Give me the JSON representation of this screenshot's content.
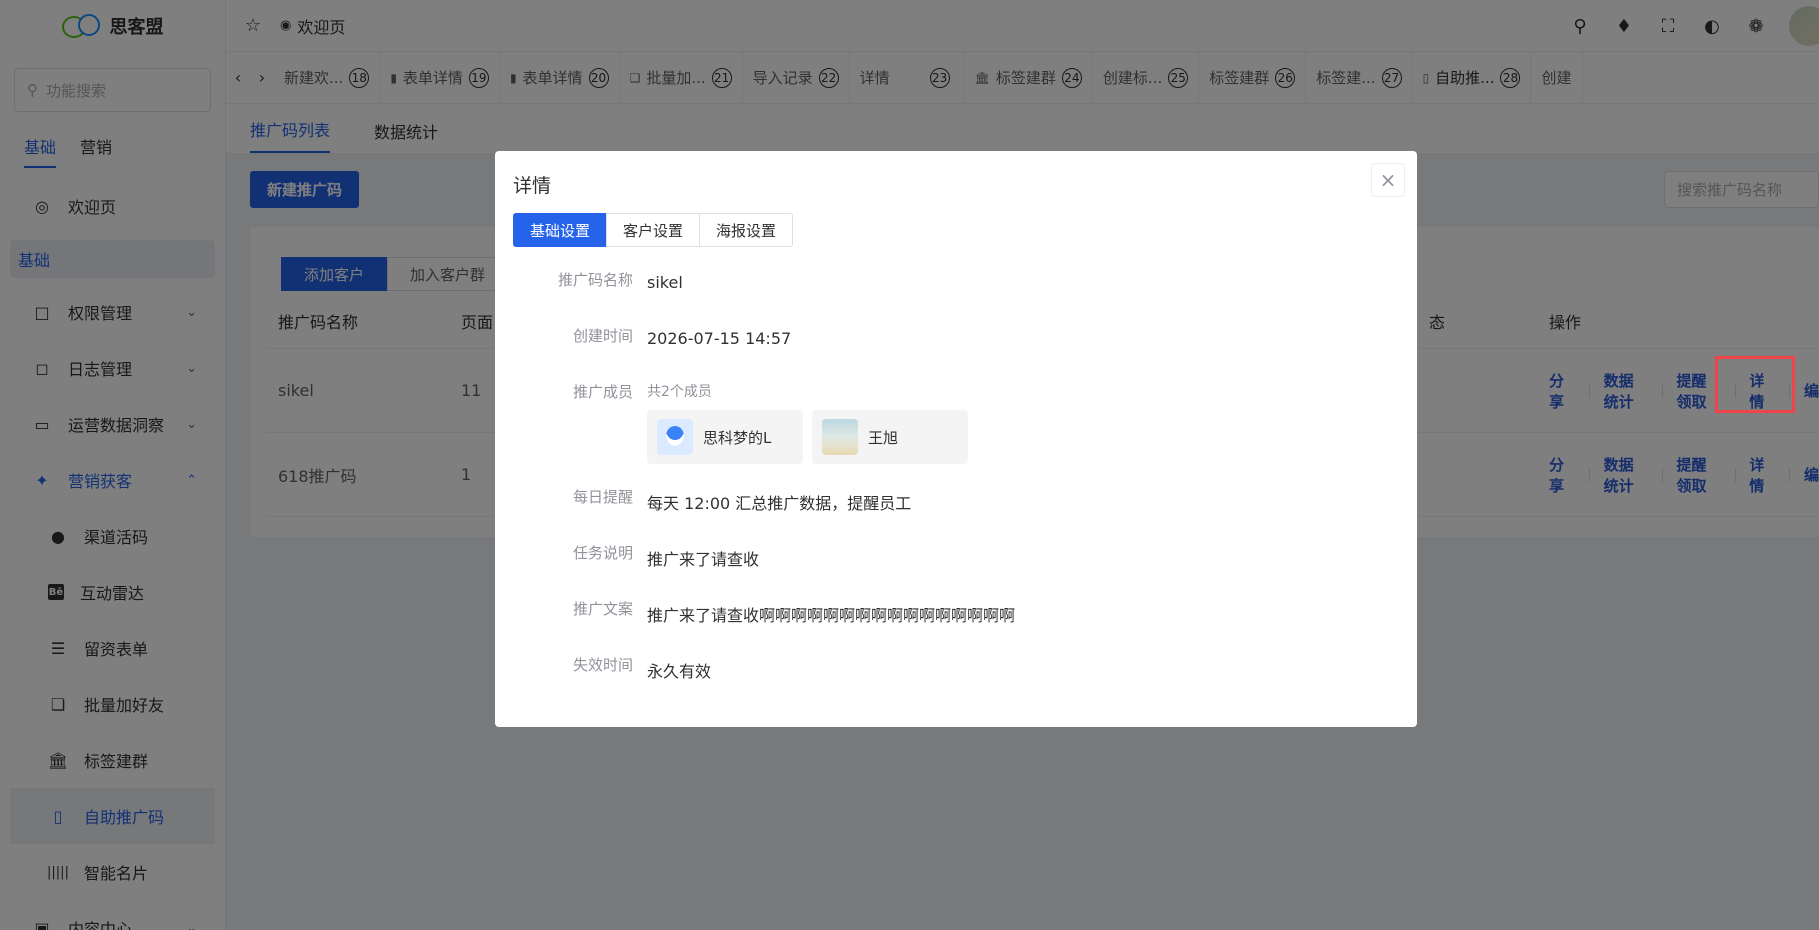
{
  "app": {
    "name": "思客盟",
    "welcome": "欢迎页"
  },
  "sidebar": {
    "search_placeholder": "功能搜索",
    "tabs": [
      "基础",
      "营销"
    ],
    "welcome": "欢迎页",
    "group": "基础",
    "items": {
      "perm": "权限管理",
      "log": "日志管理",
      "ops": "运营数据洞察",
      "marketing": "营销获客",
      "channel": "渠道活码",
      "radar": "互动雷达",
      "form": "留资表单",
      "batch": "批量加好友",
      "tag": "标签建群",
      "promo": "自助推广码",
      "card": "智能名片",
      "content": "内容中心"
    }
  },
  "tabsbar": {
    "tabs": [
      {
        "label": "新建欢...",
        "num": "18"
      },
      {
        "label": "表单详情",
        "num": "19"
      },
      {
        "label": "表单详情",
        "num": "20"
      },
      {
        "label": "批量加...",
        "num": "21"
      },
      {
        "label": "导入记录",
        "num": "22"
      },
      {
        "label": "详情",
        "num": "23"
      },
      {
        "label": "标签建群",
        "num": "24"
      },
      {
        "label": "创建标...",
        "num": "25"
      },
      {
        "label": "标签建群",
        "num": "26"
      },
      {
        "label": "标签建...",
        "num": "27"
      },
      {
        "label": "自助推...",
        "num": "28"
      },
      {
        "label": "创建",
        "num": ""
      }
    ]
  },
  "main": {
    "subtabs": [
      "推广码列表",
      "数据统计"
    ],
    "new_button": "新建推广码",
    "search_placeholder": "搜索推广码名称",
    "segments": [
      "添加客户",
      "加入客户群"
    ],
    "columns": {
      "name": "推广码名称",
      "page": "页面",
      "status": "态",
      "ops": "操作"
    },
    "rows": [
      {
        "name": "sikel",
        "page": "11"
      },
      {
        "name": "618推广码",
        "page": "1"
      }
    ],
    "ops": {
      "share": "分 享",
      "stats": "数据统计",
      "remind": "提醒领取",
      "detail": "详 情",
      "edit": "编"
    }
  },
  "modal": {
    "title": "详情",
    "tabs": [
      "基础设置",
      "客户设置",
      "海报设置"
    ],
    "fields": {
      "name_label": "推广码名称",
      "name_value": "sikel",
      "created_label": "创建时间",
      "created_value": "2026-07-15 14:57",
      "members_label": "推广成员",
      "members_count": "共2个成员",
      "member1": "思科梦的L",
      "member2": "王旭",
      "remind_label": "每日提醒",
      "remind_value": "每天 12:00 汇总推广数据，提醒员工",
      "task_label": "任务说明",
      "task_value": "推广来了请查收",
      "copy_label": "推广文案",
      "copy_value": "推广来了请查收啊啊啊啊啊啊啊啊啊啊啊啊啊啊啊啊",
      "expire_label": "失效时间",
      "expire_value": "永久有效"
    }
  },
  "colors": {
    "accent": "#2563eb",
    "highlight": "#f0434a"
  }
}
